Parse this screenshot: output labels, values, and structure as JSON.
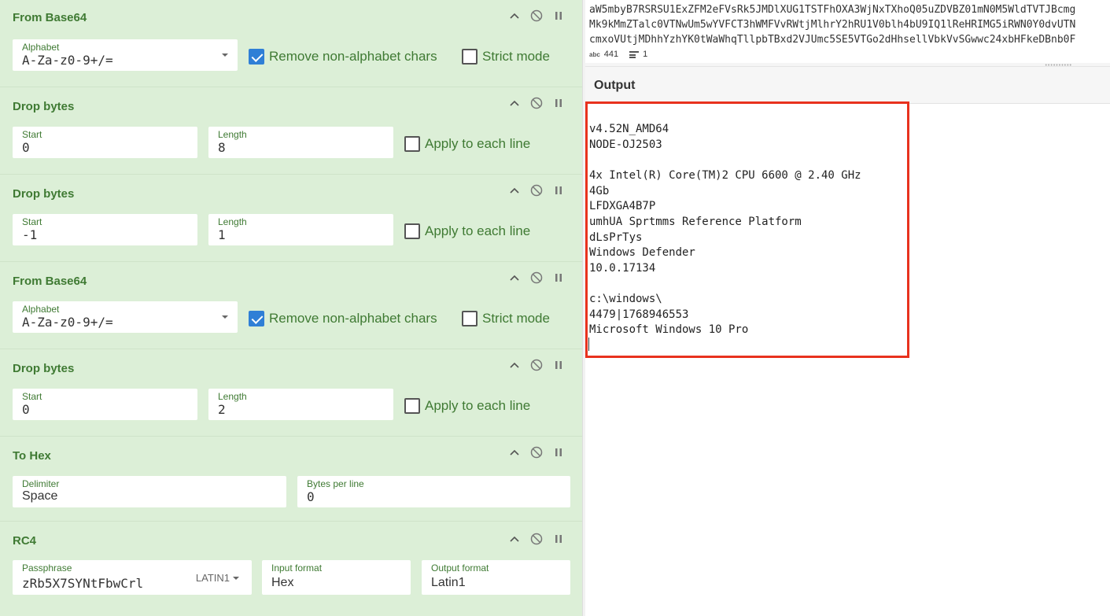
{
  "recipe": {
    "ops": [
      {
        "title": "From Base64",
        "alphabet_label": "Alphabet",
        "alphabet_value": "A-Za-z0-9+/=",
        "remove_label": "Remove non-alphabet chars",
        "strict_label": "Strict mode"
      },
      {
        "title": "Drop bytes",
        "start_label": "Start",
        "start_value": "0",
        "length_label": "Length",
        "length_value": "8",
        "apply_label": "Apply to each line"
      },
      {
        "title": "Drop bytes",
        "start_label": "Start",
        "start_value": "-1",
        "length_label": "Length",
        "length_value": "1",
        "apply_label": "Apply to each line"
      },
      {
        "title": "From Base64",
        "alphabet_label": "Alphabet",
        "alphabet_value": "A-Za-z0-9+/=",
        "remove_label": "Remove non-alphabet chars",
        "strict_label": "Strict mode"
      },
      {
        "title": "Drop bytes",
        "start_label": "Start",
        "start_value": "0",
        "length_label": "Length",
        "length_value": "2",
        "apply_label": "Apply to each line"
      },
      {
        "title": "To Hex",
        "delimiter_label": "Delimiter",
        "delimiter_value": "Space",
        "bpl_label": "Bytes per line",
        "bpl_value": "0"
      },
      {
        "title": "RC4",
        "passphrase_label": "Passphrase",
        "passphrase_value": "zRb5X7SYNtFbwCrl",
        "passphrase_encoding": "LATIN1",
        "input_format_label": "Input format",
        "input_format_value": "Hex",
        "output_format_label": "Output format",
        "output_format_value": "Latin1"
      }
    ]
  },
  "input": {
    "lines": [
      "aW5mbyB7RSRSU1ExZFM2eFVsRk5JMDlXUG1TSTFhOXA3WjNxTXhoQ05uZDVBZ01mN0M5WldTVTJBcmg",
      "Mk9kMmZTalc0VTNwUm5wYVFCT3hWMFVvRWtjMlhrY2hRU1V0blh4bU9IQ1lReHRIMG5iRWN0Y0dvUTN",
      "cmxoVUtjMDhhYzhYK0tWaWhqTllpbTBxd2VJUmc5SE5VTGo2dHhsellVbkVvSGwwc24xbHFkeDBnb0F"
    ],
    "char_count_label": "abc",
    "char_count": "441",
    "line_count": "1"
  },
  "output": {
    "title": "Output",
    "lines": [
      "v4.52N_AMD64",
      "NODE-OJ2503",
      "",
      "4x Intel(R) Core(TM)2 CPU 6600 @ 2.40 GHz",
      "4Gb",
      "LFDXGA4B7P",
      "umhUA Sprtmms Reference Platform",
      "dLsPrTys",
      "Windows Defender",
      "10.0.17134",
      "",
      "c:\\windows\\",
      "4479|1768946553",
      "Microsoft Windows 10 Pro"
    ]
  },
  "colors": {
    "recipe_bg": "#dcefd7",
    "accent_green": "#3f7a33",
    "checkbox_blue": "#2f7fd6",
    "highlight_red": "#e8321e"
  }
}
